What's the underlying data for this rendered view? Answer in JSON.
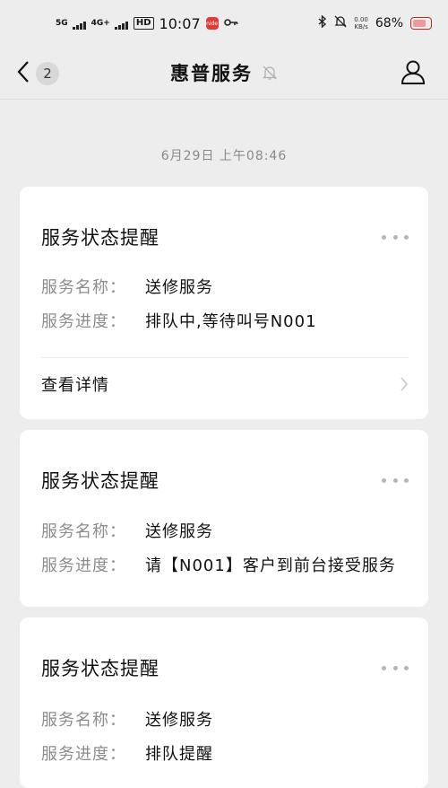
{
  "status_bar": {
    "net1": "5G",
    "net2": "4G+",
    "hd": "HD",
    "time": "10:07",
    "app_badge": "nide",
    "speed_value": "0.00",
    "speed_unit": "KB/s",
    "battery": "68%",
    "icons": [
      "signal-icon",
      "bluetooth-icon",
      "mute-icon",
      "battery-icon"
    ]
  },
  "nav": {
    "title": "惠普服务",
    "unread_count": "2",
    "icons": [
      "back-icon",
      "bell-off-icon",
      "profile-icon"
    ]
  },
  "timestamp": "6月29日 上午08:46",
  "cards": [
    {
      "title": "服务状态提醒",
      "rows": [
        {
          "label": "服务名称：",
          "value": "送修服务"
        },
        {
          "label": "服务进度：",
          "value": "排队中,等待叫号N001"
        }
      ],
      "link_label": "查看详情"
    },
    {
      "title": "服务状态提醒",
      "rows": [
        {
          "label": "服务名称：",
          "value": "送修服务"
        },
        {
          "label": "服务进度：",
          "value": "请【N001】客户到前台接受服务"
        }
      ]
    },
    {
      "title": "服务状态提醒",
      "rows": [
        {
          "label": "服务名称：",
          "value": "送修服务"
        },
        {
          "label": "服务进度：",
          "value": "排队提醒"
        }
      ]
    }
  ],
  "colors": {
    "background": "#ededed",
    "card": "#ffffff",
    "label": "#8c8c8c",
    "battery": "#c62828"
  }
}
